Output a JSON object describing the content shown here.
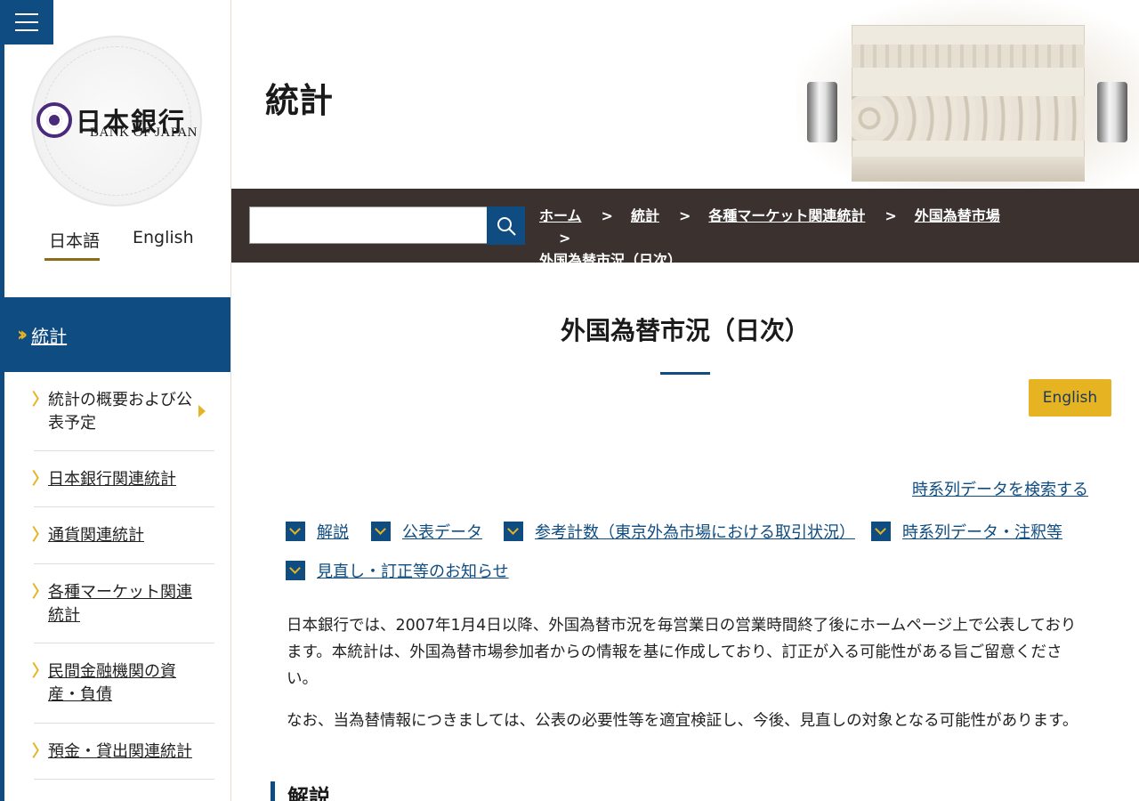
{
  "sidebar": {
    "logo": {
      "jp_name": "日本銀行",
      "en_name": "BANK OF JAPAN"
    },
    "languages": {
      "ja": "日本語",
      "en": "English"
    },
    "section_label": "統計",
    "items": [
      {
        "label": "統計の概要および公表予定"
      },
      {
        "label": "日本銀行関連統計"
      },
      {
        "label": "通貨関連統計"
      },
      {
        "label": "各種マーケット関連統計"
      },
      {
        "label": "民間金融機関の資産・負債"
      },
      {
        "label": "預金・貸出関連統計"
      }
    ]
  },
  "header": {
    "title": "統計"
  },
  "search": {
    "value": ""
  },
  "breadcrumb": {
    "items": [
      "ホーム",
      "統計",
      "各種マーケット関連統計",
      "外国為替市場"
    ],
    "separator": ">",
    "current": "外国為替市況（日次）"
  },
  "main": {
    "title": "外国為替市況（日次）",
    "english_button": "English",
    "timeseries_link": "時系列データを検索する",
    "anchors": [
      "解説",
      "公表データ",
      "参考計数（東京外為市場における取引状況）",
      "時系列データ・注釈等",
      "見直し・訂正等のお知らせ"
    ],
    "paragraph1": "日本銀行では、2007年1月4日以降、外国為替市況を毎営業日の営業時間終了後にホームページ上で公表しております。本統計は、外国為替市場参加者からの情報を基に作成しており、訂正が入る可能性がある旨ご留意ください。",
    "paragraph2": "なお、当為替情報につきましては、公表の必要性等を適宜検証し、今後、見直しの対象となる可能性があります。",
    "section_heading": "解説"
  },
  "colors": {
    "brand_blue": "#0f4c81",
    "accent_gold": "#e6b422",
    "bar_brown": "#3b3230"
  }
}
